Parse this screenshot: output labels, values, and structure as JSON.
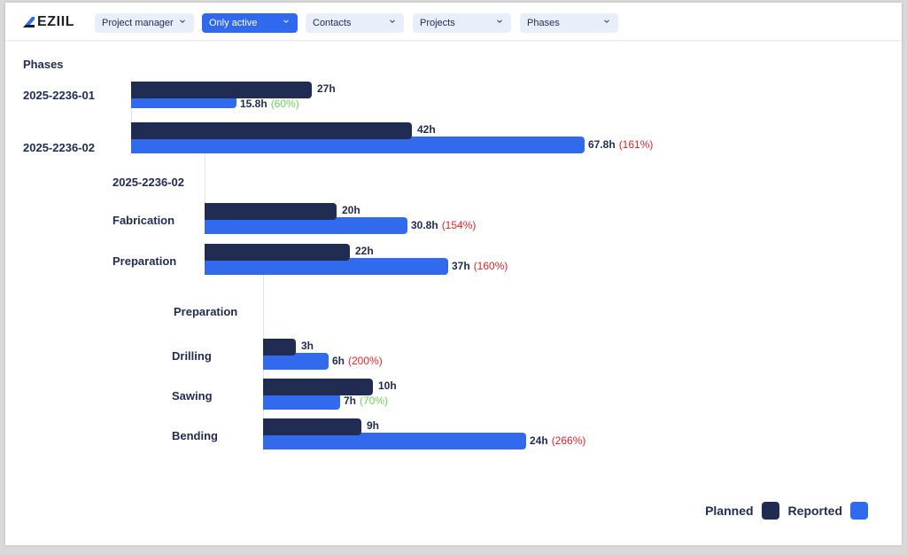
{
  "app": {
    "logo_text": "EZIIL"
  },
  "filters": [
    {
      "label": "Project manager",
      "active": false
    },
    {
      "label": "Only active",
      "active": true
    },
    {
      "label": "Contacts",
      "active": false
    },
    {
      "label": "Projects",
      "active": false
    },
    {
      "label": "Phases",
      "active": false
    }
  ],
  "colors": {
    "planned": "#212c53",
    "reported": "#316aed",
    "over": "#e0242b",
    "under": "#6ccf5a",
    "accent": "#3169ee"
  },
  "chart_data": {
    "type": "bar",
    "orientation": "horizontal",
    "title": "Phases",
    "unit": "h",
    "legend": {
      "placement": "bottom-right",
      "entries": [
        "Planned",
        "Reported"
      ]
    },
    "groups": [
      {
        "title": "Phases",
        "categories": [
          "2025-2236-01",
          "2025-2236-02"
        ],
        "series": [
          {
            "name": "Planned",
            "values": [
              27,
              42
            ]
          },
          {
            "name": "Reported",
            "values": [
              15.8,
              67.8
            ]
          }
        ],
        "planned_labels": [
          "27h",
          "42h"
        ],
        "reported_labels": [
          "15.8h",
          "67.8h"
        ],
        "percent_labels": [
          "(60%)",
          "(161%)"
        ],
        "over_budget": [
          false,
          true
        ]
      },
      {
        "title": "2025-2236-02",
        "categories": [
          "Fabrication",
          "Preparation"
        ],
        "series": [
          {
            "name": "Planned",
            "values": [
              20,
              22
            ]
          },
          {
            "name": "Reported",
            "values": [
              30.8,
              37
            ]
          }
        ],
        "planned_labels": [
          "20h",
          "22h"
        ],
        "reported_labels": [
          "30.8h",
          "37h"
        ],
        "percent_labels": [
          "(154%)",
          "(160%)"
        ],
        "over_budget": [
          true,
          true
        ]
      },
      {
        "title": "Preparation",
        "categories": [
          "Drilling",
          "Sawing",
          "Bending"
        ],
        "series": [
          {
            "name": "Planned",
            "values": [
              3,
              10,
              9
            ]
          },
          {
            "name": "Reported",
            "values": [
              6,
              7,
              24
            ]
          }
        ],
        "planned_labels": [
          "3h",
          "10h",
          "9h"
        ],
        "reported_labels": [
          "6h",
          "7h",
          "24h"
        ],
        "percent_labels": [
          "(200%)",
          "(70%)",
          "(266%)"
        ],
        "over_budget": [
          true,
          false,
          true
        ]
      }
    ]
  }
}
